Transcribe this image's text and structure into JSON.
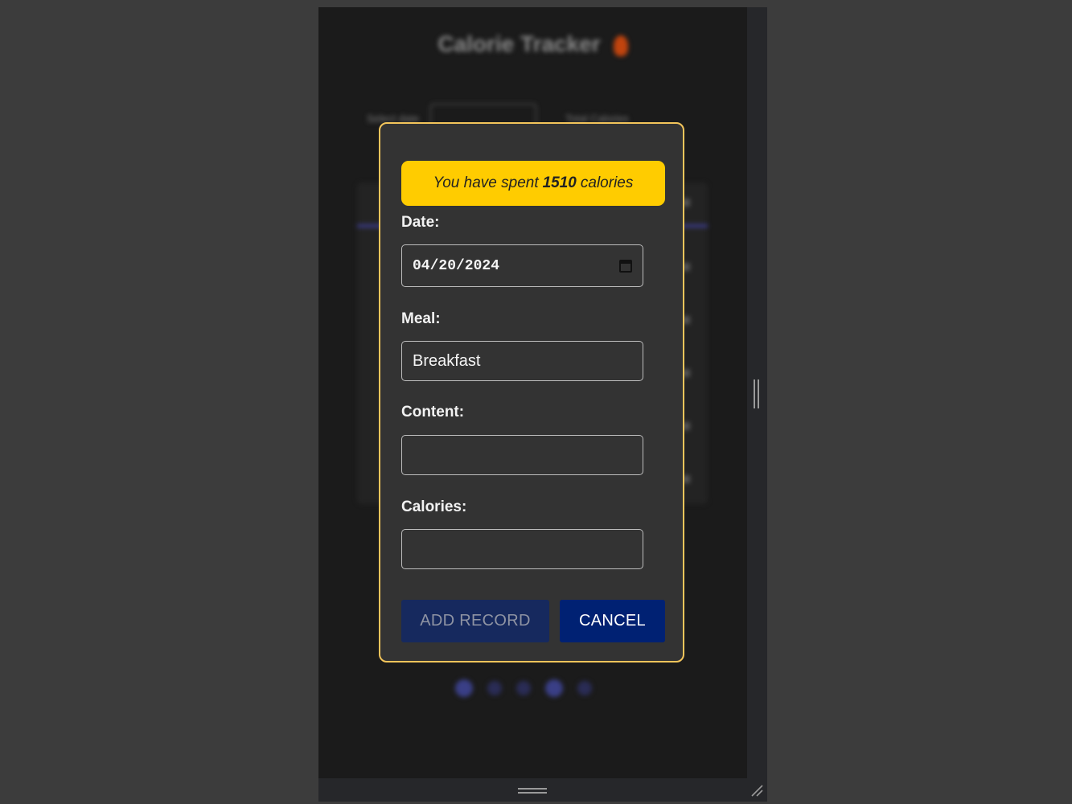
{
  "background": {
    "title": "Calorie Tracker",
    "date_label": "Select date",
    "total_label": "Total Calories"
  },
  "modal": {
    "banner": {
      "prefix": "You have spent",
      "value": "1510",
      "suffix": "calories",
      "color": "#ffcc00"
    },
    "date": {
      "label": "Date:",
      "value": "04/20/2024"
    },
    "meal": {
      "label": "Meal:",
      "value": "Breakfast"
    },
    "content": {
      "label": "Content:",
      "value": ""
    },
    "calories": {
      "label": "Calories:",
      "value": ""
    },
    "buttons": {
      "add": "ADD RECORD",
      "cancel": "CANCEL"
    },
    "border_color": "#f3c55b",
    "button_color": "#002173"
  },
  "icons": {
    "calendar": "calendar-icon",
    "resize": "resize-handle-icon"
  }
}
